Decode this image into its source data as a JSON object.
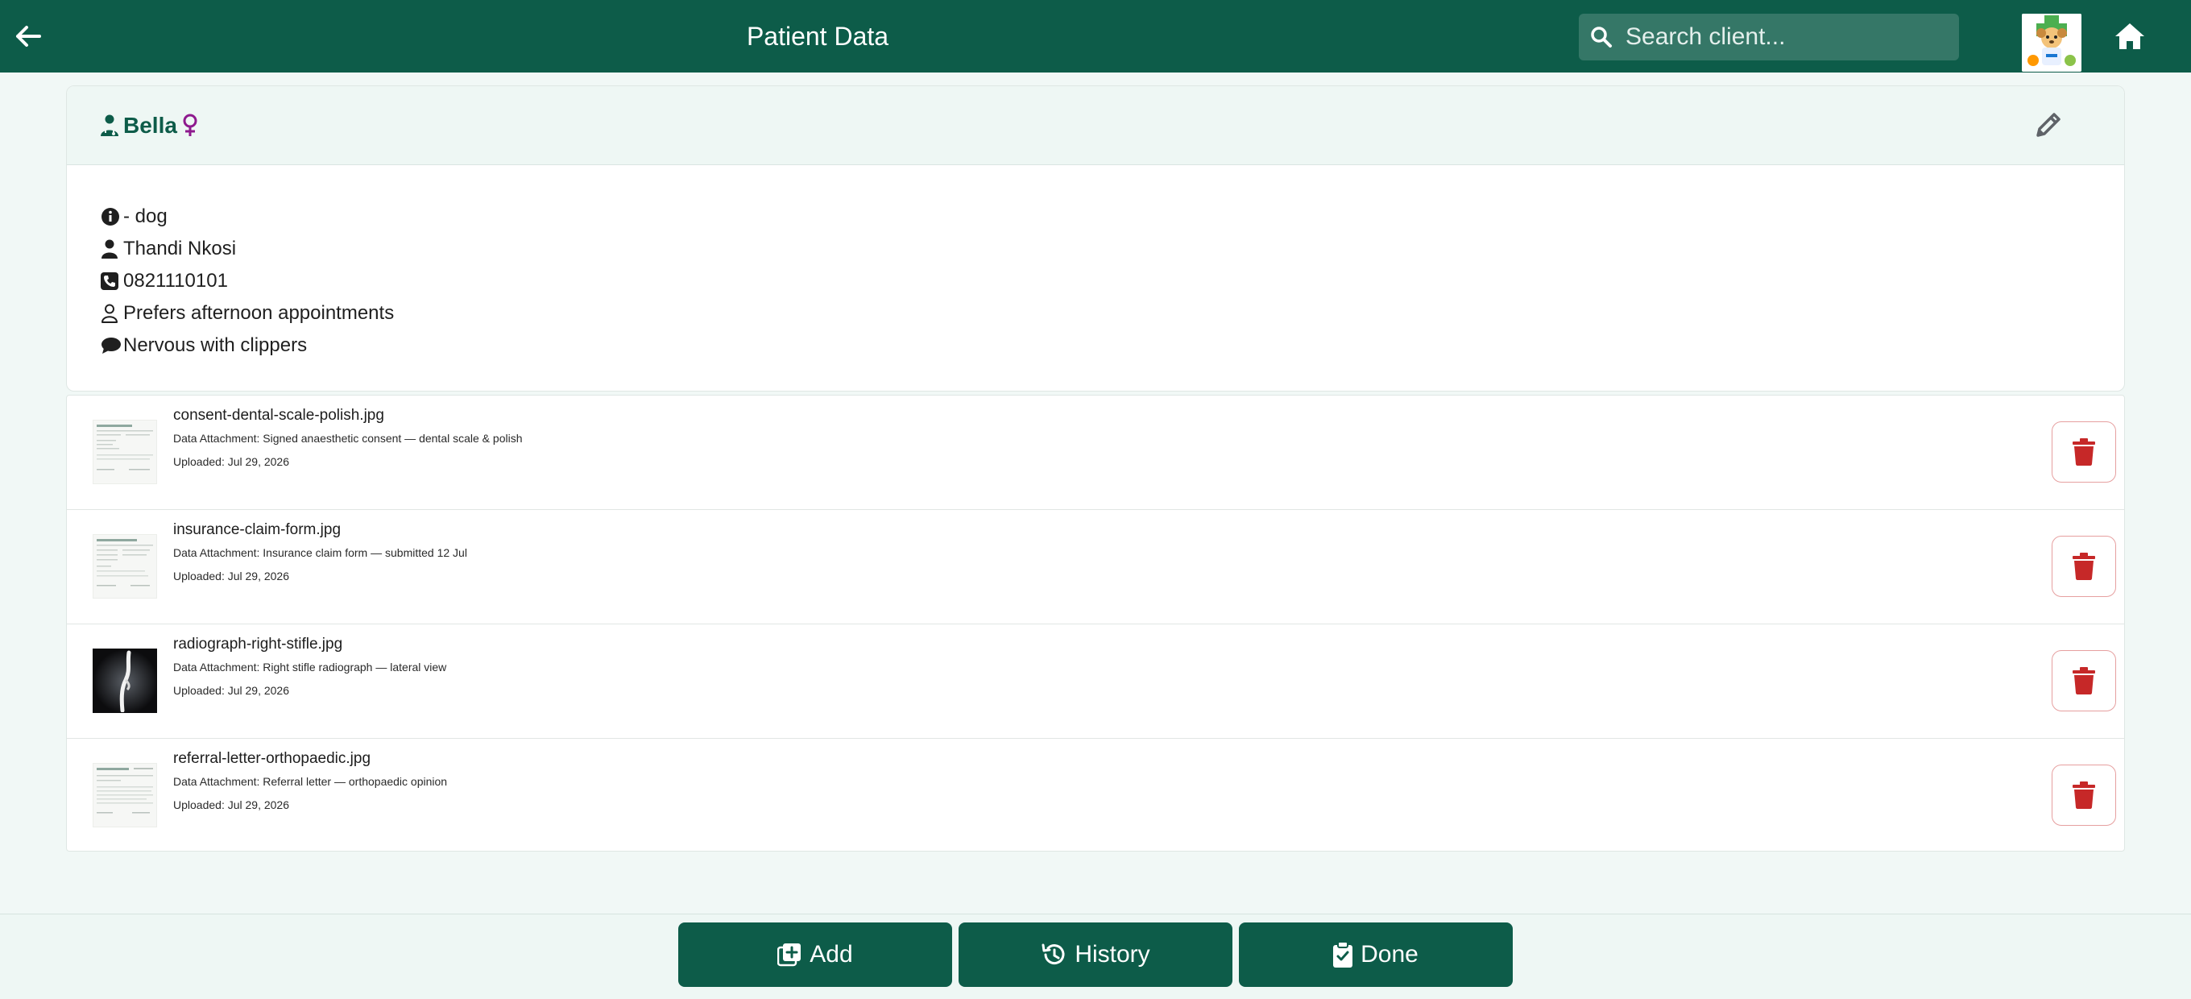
{
  "header": {
    "title": "Patient Data",
    "search_placeholder": "Search client..."
  },
  "patient": {
    "name": "Bella",
    "species_line": "- dog",
    "owner": "Thandi Nkosi",
    "phone": "0821110101",
    "preference": "Prefers afternoon appointments",
    "note": "Nervous with clippers"
  },
  "attachments": [
    {
      "filename": "consent-dental-scale-polish.jpg",
      "description": "Data Attachment: Signed anaesthetic consent — dental scale & polish",
      "uploaded": "Uploaded: Jul 29, 2026",
      "thumb": "document"
    },
    {
      "filename": "insurance-claim-form.jpg",
      "description": "Data Attachment: Insurance claim form — submitted 12 Jul",
      "uploaded": "Uploaded: Jul 29, 2026",
      "thumb": "document"
    },
    {
      "filename": "radiograph-right-stifle.jpg",
      "description": "Data Attachment: Right stifle radiograph — lateral view",
      "uploaded": "Uploaded: Jul 29, 2026",
      "thumb": "xray"
    },
    {
      "filename": "referral-letter-orthopaedic.jpg",
      "description": "Data Attachment: Referral letter — orthopaedic opinion",
      "uploaded": "Uploaded: Jul 29, 2026",
      "thumb": "document"
    }
  ],
  "footer": {
    "add_label": "Add",
    "history_label": "History",
    "done_label": "Done"
  },
  "colors": {
    "primary": "#0d5c49",
    "delete": "#c62828",
    "female": "#8e1a8e"
  },
  "icons": {
    "back": "arrow-left-icon",
    "search": "search-icon",
    "home": "home-icon",
    "edit": "pencil-icon",
    "delete": "trash-icon"
  }
}
